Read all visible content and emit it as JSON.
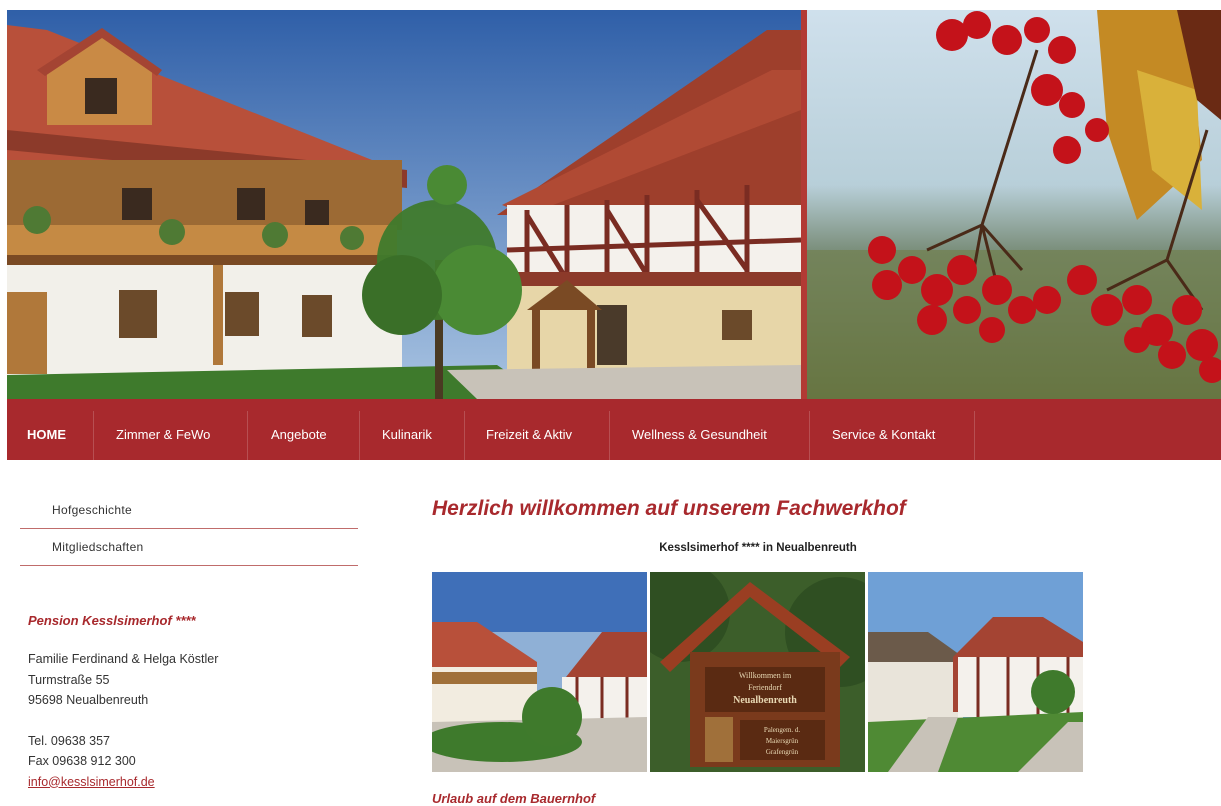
{
  "nav": {
    "items": [
      {
        "label": "HOME",
        "active": true
      },
      {
        "label": "Zimmer & FeWo"
      },
      {
        "label": "Angebote"
      },
      {
        "label": "Kulinarik"
      },
      {
        "label": "Freizeit & Aktiv"
      },
      {
        "label": "Wellness & Gesundheit"
      },
      {
        "label": "Service & Kontakt"
      }
    ]
  },
  "sidebar": {
    "links": [
      "Hofgeschichte",
      "Mitgliedschaften"
    ],
    "title": "Pension Kesslsimerhof ****",
    "address": {
      "line1": "Familie Ferdinand & Helga Köstler",
      "line2": "Turmstraße 55",
      "line3": "95698 Neualbenreuth",
      "phone": "Tel.  09638 357",
      "fax": "Fax 09638 912 300",
      "email": "info@kesslsimerhof.de"
    }
  },
  "main": {
    "title": "Herzlich willkommen auf unserem Fachwerkhof",
    "subtitle": "Kesslsimerhof ****  in Neualbenreuth",
    "section_title": "Urlaub auf dem Bauernhof",
    "sign_text": [
      "Willkommen im",
      "Feriendorf",
      "Neualbenreuth",
      "Palengem. d.",
      "Maiersgrün",
      "Grafengrün"
    ]
  },
  "colors": {
    "brand": "#a8292d",
    "divider": "#c06c6b"
  }
}
